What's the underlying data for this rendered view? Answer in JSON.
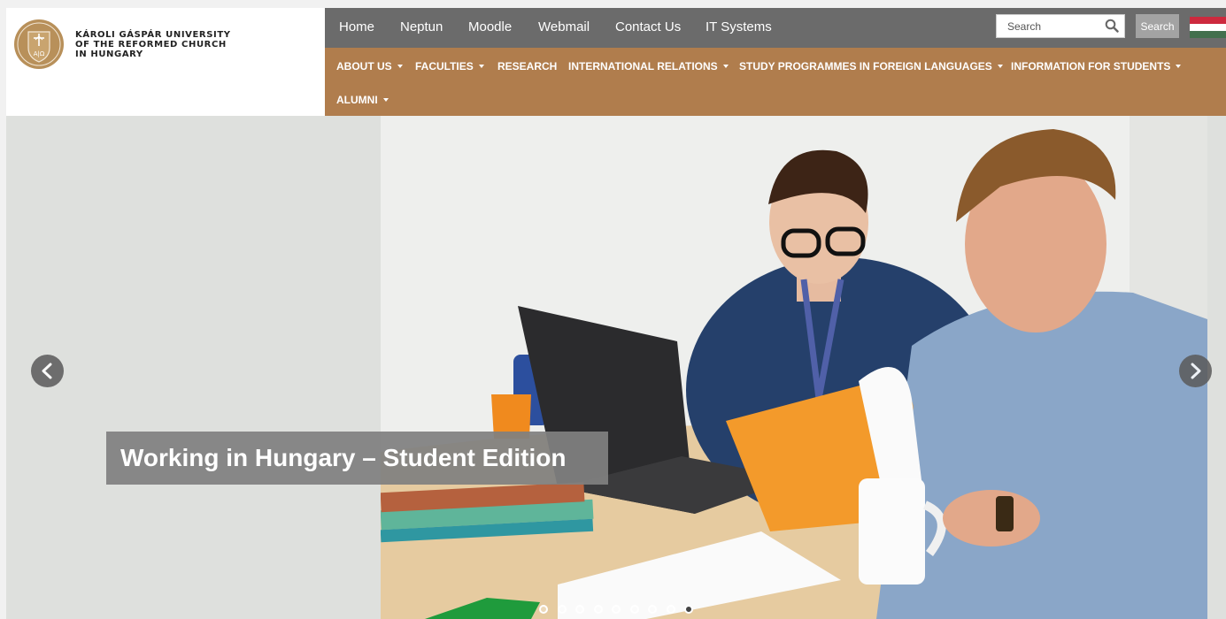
{
  "university": {
    "name_lines": [
      "KÁROLI GÁSPÁR UNIVERSITY",
      "OF THE REFORMED CHURCH",
      "IN HUNGARY"
    ],
    "seal_text": "A|Ω"
  },
  "topnav": [
    "Home",
    "Neptun",
    "Moodle",
    "Webmail",
    "Contact Us",
    "IT Systems"
  ],
  "search": {
    "placeholder": "Search",
    "button_label": "Search"
  },
  "mainnav": [
    {
      "label": "ABOUT US",
      "dropdown": true
    },
    {
      "label": "FACULTIES",
      "dropdown": true
    },
    {
      "label": "RESEARCH",
      "dropdown": false
    },
    {
      "label": "INTERNATIONAL RELATIONS",
      "dropdown": true
    },
    {
      "label": "STUDY PROGRAMMES IN FOREIGN LANGUAGES",
      "dropdown": true
    },
    {
      "label": "INFORMATION FOR STUDENTS",
      "dropdown": true
    },
    {
      "label": "ALUMNI",
      "dropdown": true
    }
  ],
  "slider": {
    "caption": "Working in Hungary – Student Edition",
    "slide_count": 9,
    "active_slide": 9
  },
  "colors": {
    "topbar": "#6b6b6b",
    "mainnav": "#b07d4d",
    "brand_gold": "#b8905a"
  },
  "icons": [
    "search-icon",
    "chevron-left-icon",
    "chevron-right-icon",
    "hungarian-flag-icon",
    "university-seal-icon"
  ]
}
